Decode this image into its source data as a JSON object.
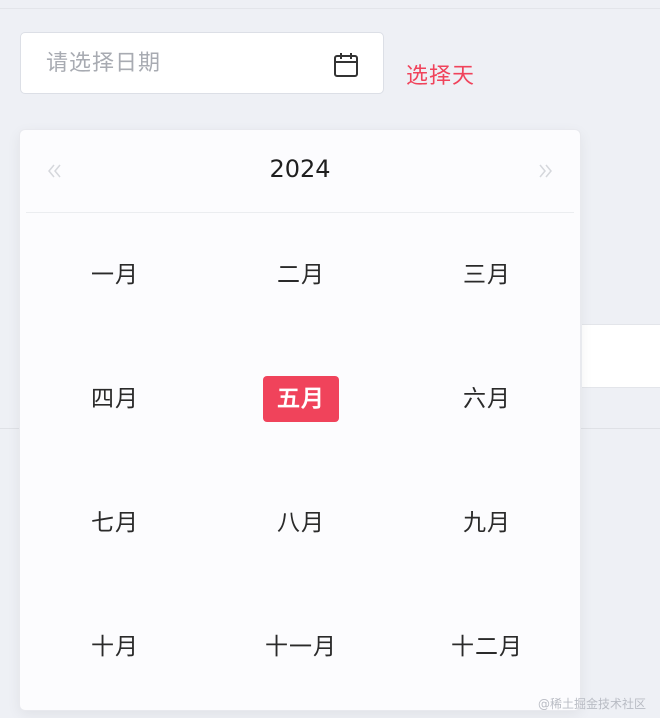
{
  "date_input": {
    "placeholder": "请选择日期",
    "icon": "calendar-icon"
  },
  "select_day_label": "选择天",
  "picker": {
    "year": "2024",
    "prev_icon": "double-chevron-left-icon",
    "next_icon": "double-chevron-right-icon",
    "months": [
      {
        "label": "一月",
        "selected": false
      },
      {
        "label": "二月",
        "selected": false
      },
      {
        "label": "三月",
        "selected": false
      },
      {
        "label": "四月",
        "selected": false
      },
      {
        "label": "五月",
        "selected": true
      },
      {
        "label": "六月",
        "selected": false
      },
      {
        "label": "七月",
        "selected": false
      },
      {
        "label": "八月",
        "selected": false
      },
      {
        "label": "九月",
        "selected": false
      },
      {
        "label": "十月",
        "selected": false
      },
      {
        "label": "十一月",
        "selected": false
      },
      {
        "label": "十二月",
        "selected": false
      }
    ]
  },
  "colors": {
    "accent": "#f0435b",
    "placeholder": "#a8abb2",
    "background": "#eef0f5"
  },
  "watermark": "@稀土掘金技术社区"
}
